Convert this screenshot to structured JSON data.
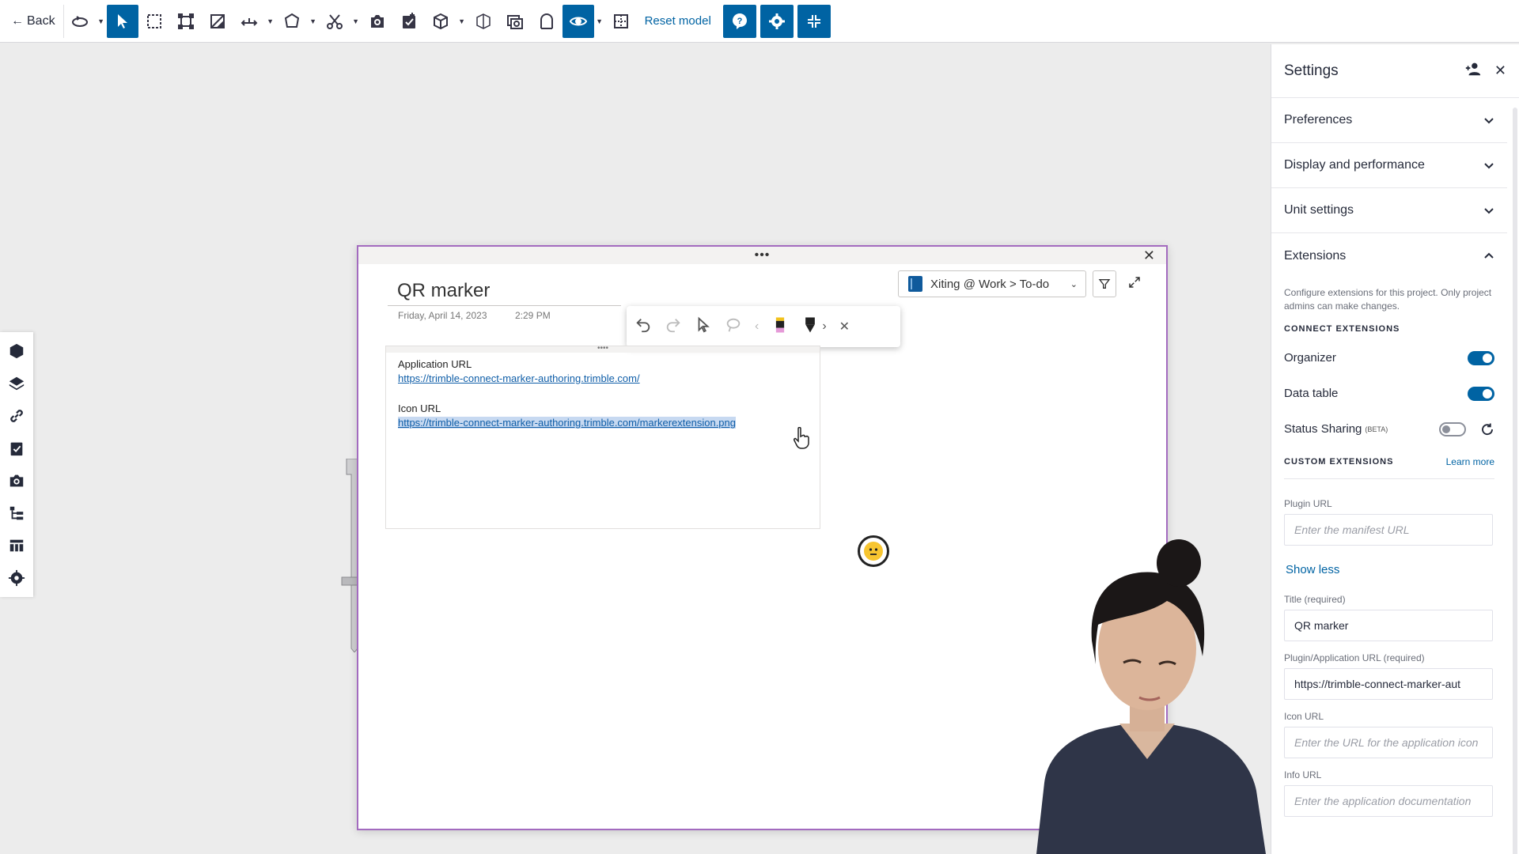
{
  "toolbar": {
    "back_label": "Back",
    "reset_label": "Reset model"
  },
  "note": {
    "title": "QR marker",
    "date": "Friday, April 14, 2023",
    "time": "2:29 PM",
    "notebook": "Xiting @ Work > To-do",
    "app_url_label": "Application URL",
    "app_url": "https://trimble-connect-marker-authoring.trimble.com/",
    "icon_url_label": "Icon URL",
    "icon_url": "https://trimble-connect-marker-authoring.trimble.com/markerextension.png"
  },
  "settings": {
    "title": "Settings",
    "sections": {
      "preferences": "Preferences",
      "display": "Display and performance",
      "units": "Unit settings",
      "extensions": "Extensions"
    },
    "extensions_desc": "Configure extensions for this project. Only project admins can make changes.",
    "connect_heading": "CONNECT EXTENSIONS",
    "organizer": "Organizer",
    "data_table": "Data table",
    "status_sharing": "Status Sharing",
    "beta": "(BETA)",
    "custom_heading": "CUSTOM EXTENSIONS",
    "learn_more": "Learn more",
    "plugin_url_label": "Plugin URL",
    "plugin_url_placeholder": "Enter the manifest URL",
    "show_less": "Show less",
    "title_label": "Title (required)",
    "title_value": "QR marker",
    "app_url_label": "Plugin/Application URL (required)",
    "app_url_value": "https://trimble-connect-marker-aut",
    "icon_url_label": "Icon URL",
    "icon_url_placeholder": "Enter the URL for the application icon",
    "info_url_label": "Info URL",
    "info_url_placeholder": "Enter the application documentation"
  },
  "colors": {
    "accent": "#0063a3",
    "note_border": "#a36bbf"
  }
}
